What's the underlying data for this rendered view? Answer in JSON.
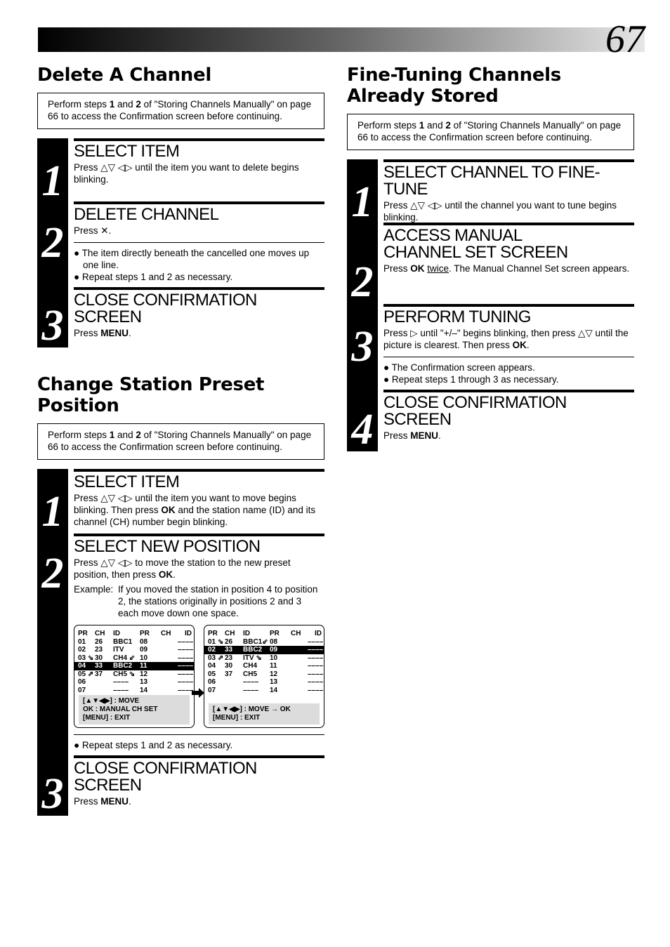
{
  "page": {
    "number": "67"
  },
  "delete_channel": {
    "title": "Delete A Channel",
    "note": {
      "pre": "Perform steps ",
      "s1": "1",
      "mid": " and ",
      "s2": "2",
      "post": " of \"Storing Channels Manually\" on page 66 to access the Confirmation screen before continuing."
    },
    "steps": [
      {
        "number": "1",
        "heading": "SELECT ITEM",
        "text": "Press △▽ ◁▷ until the item you want to delete begins blinking."
      },
      {
        "number": "2",
        "heading": "DELETE CHANNEL",
        "text": "Press ✕.",
        "bullets": [
          "The item directly beneath the cancelled one moves up one line.",
          "Repeat steps 1 and 2 as necessary."
        ]
      },
      {
        "number": "3",
        "heading": "CLOSE CONFIRMATION SCREEN",
        "text_pre": "Press ",
        "text_bold": "MENU",
        "text_post": "."
      }
    ]
  },
  "change_preset": {
    "title_line1": "Change Station Preset",
    "title_line2": "Position",
    "note": {
      "pre": "Perform steps ",
      "s1": "1",
      "mid": " and ",
      "s2": "2",
      "post": " of \"Storing Channels Manually\" on page 66 to access the Confirmation screen before continuing."
    },
    "steps": [
      {
        "number": "1",
        "heading": "SELECT ITEM",
        "text_pre": "Press △▽ ◁▷ until the item you want to move begins blinking. Then press ",
        "text_bold": "OK",
        "text_post": " and the station name (ID) and its channel (CH) number begin blinking."
      },
      {
        "number": "2",
        "heading": "SELECT NEW POSITION",
        "text_pre": "Press △▽ ◁▷ to move the station to the new preset position, then press ",
        "text_bold": "OK",
        "text_post": ".",
        "example_label": "Example:",
        "example_text": "If you moved the station in position 4 to position 2, the stations originally in positions 2 and 3 each move down one space."
      },
      {
        "number": "3",
        "bullet": "Repeat steps 1 and 2 as necessary.",
        "heading": "CLOSE CONFIRMATION SCREEN",
        "text_pre": "Press ",
        "text_bold": "MENU",
        "text_post": "."
      }
    ],
    "screen_before": {
      "headers": [
        "PR",
        "CH",
        "ID",
        "PR",
        "CH",
        "ID"
      ],
      "rows": [
        [
          "01",
          "26",
          "BBC1",
          "08",
          "",
          "----"
        ],
        [
          "02",
          "23",
          "ITV",
          "09",
          "",
          "----"
        ],
        [
          "03 ⇘",
          "30",
          "CH4 ⇙",
          "10",
          "",
          "----"
        ],
        [
          "04",
          "33",
          "BBC2",
          "11",
          "",
          "----"
        ],
        [
          "05 ⇗",
          "37",
          "CH5 ⇘",
          "12",
          "",
          "----"
        ],
        [
          "06",
          "",
          "----",
          "13",
          "",
          "----"
        ],
        [
          "07",
          "",
          "----",
          "14",
          "",
          "----"
        ]
      ],
      "highlighted_row": 3,
      "footer": [
        "[▲▼◀▶] : MOVE",
        "OK : MANUAL CH SET",
        "[MENU] : EXIT"
      ]
    },
    "screen_after": {
      "headers": [
        "PR",
        "CH",
        "ID",
        "PR",
        "CH",
        "ID"
      ],
      "rows": [
        [
          "01 ⇘",
          "26",
          "BBC1⇙",
          "08",
          "",
          "----"
        ],
        [
          "02",
          "33",
          "BBC2",
          "09",
          "",
          "----"
        ],
        [
          "03 ⇗",
          "23",
          "ITV ⇘",
          "10",
          "",
          "----"
        ],
        [
          "04",
          "30",
          "CH4",
          "11",
          "",
          "----"
        ],
        [
          "05",
          "37",
          "CH5",
          "12",
          "",
          "----"
        ],
        [
          "06",
          "",
          "----",
          "13",
          "",
          "----"
        ],
        [
          "07",
          "",
          "----",
          "14",
          "",
          "----"
        ]
      ],
      "highlighted_row": 1,
      "footer": [
        "[▲▼◀▶] : MOVE → OK",
        "[MENU] : EXIT"
      ]
    }
  },
  "fine_tuning": {
    "title_line1": "Fine-Tuning Channels",
    "title_line2": "Already Stored",
    "note": {
      "pre": "Perform steps ",
      "s1": "1",
      "mid": " and ",
      "s2": "2",
      "post": " of \"Storing Channels Manually\" on page 66 to access the Confirmation screen before continuing."
    },
    "steps": [
      {
        "number": "1",
        "heading": "SELECT CHANNEL TO FINE-TUNE",
        "text": "Press △▽ ◁▷ until the channel you want to tune begins blinking."
      },
      {
        "number": "2",
        "heading_line1": "ACCESS MANUAL",
        "heading_line2": "CHANNEL SET SCREEN",
        "text_pre": "Press ",
        "text_bold": "OK",
        "text_mid": " ",
        "text_underline": "twice",
        "text_post": ". The Manual Channel Set screen appears."
      },
      {
        "number": "3",
        "heading": "PERFORM TUNING",
        "text_pre": "Press ▷ until \"+/–\" begins blinking, then press △▽ until the picture is clearest. Then press ",
        "text_bold": "OK",
        "text_post": ".",
        "bullets": [
          "The Confirmation screen appears.",
          "Repeat steps 1 through 3 as necessary."
        ]
      },
      {
        "number": "4",
        "heading": "CLOSE CONFIRMATION SCREEN",
        "text_pre": "Press ",
        "text_bold": "MENU",
        "text_post": "."
      }
    ]
  }
}
